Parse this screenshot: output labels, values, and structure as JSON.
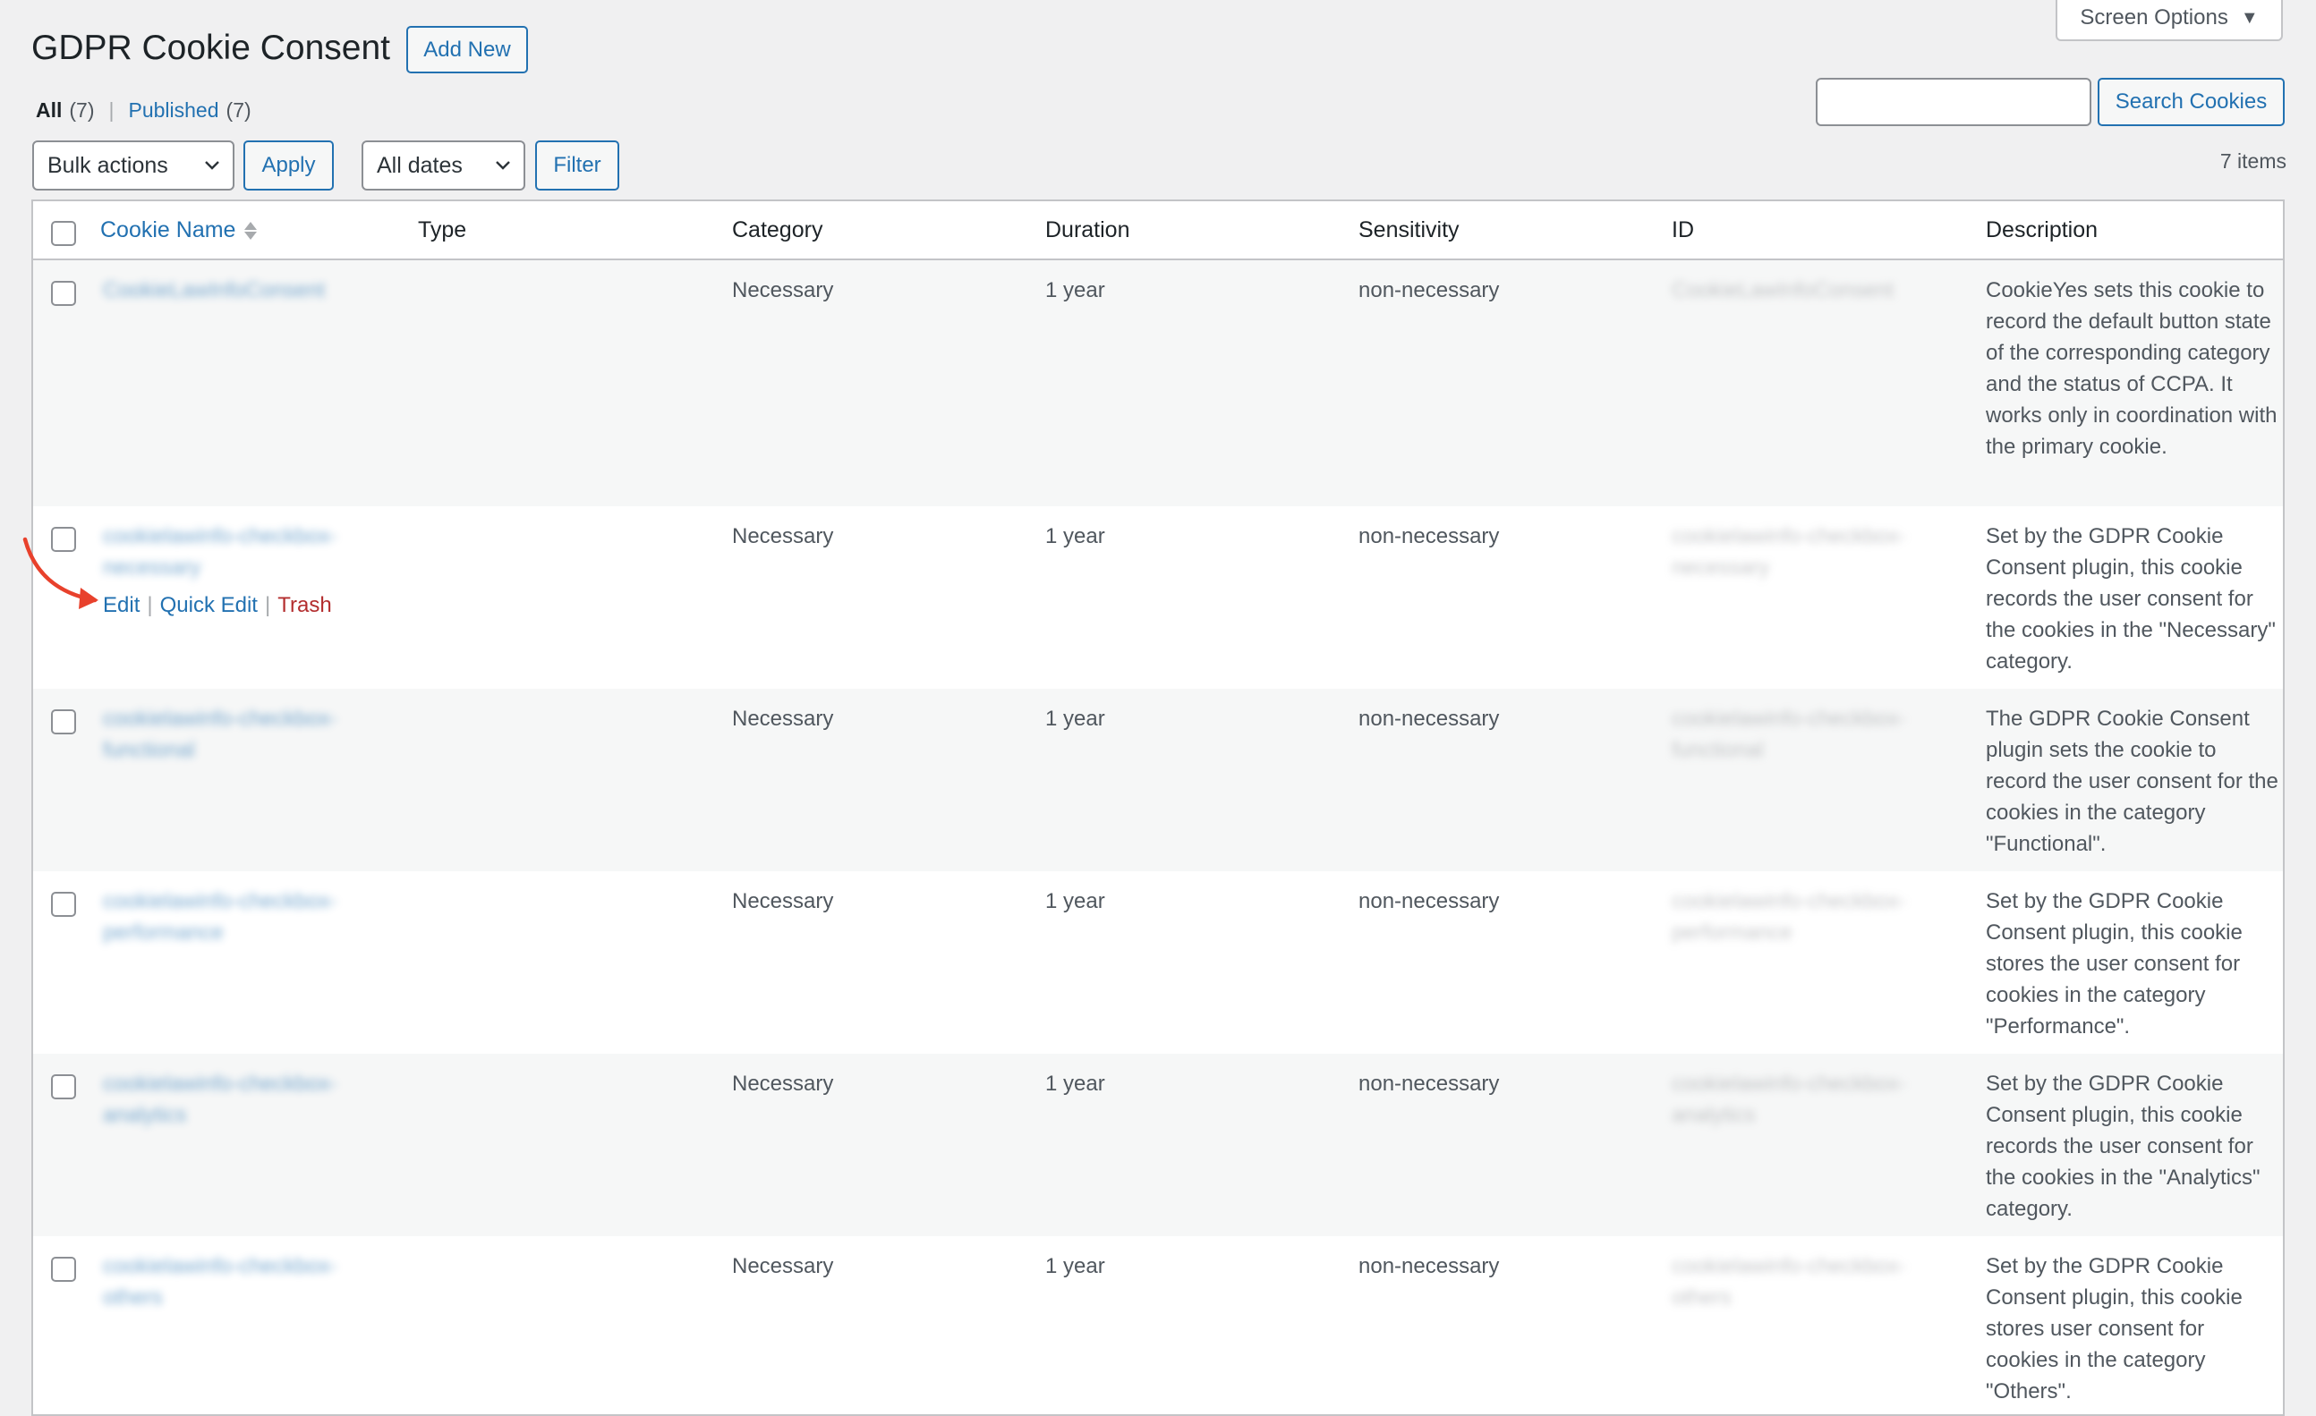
{
  "screen_options": {
    "label": "Screen Options",
    "icon": "triangle-down-icon"
  },
  "title": "GDPR Cookie Consent",
  "add_new": "Add New",
  "views": {
    "all": {
      "label": "All",
      "count": "(7)"
    },
    "sep": "|",
    "published": {
      "label": "Published",
      "count": "(7)"
    }
  },
  "search": {
    "value": "",
    "button": "Search Cookies"
  },
  "bulk_actions": {
    "selected": "Bulk actions",
    "apply": "Apply"
  },
  "dates": {
    "selected": "All dates",
    "filter": "Filter"
  },
  "items_count": "7 items",
  "columns": {
    "name": "Cookie Name",
    "type": "Type",
    "category": "Category",
    "duration": "Duration",
    "sensitivity": "Sensitivity",
    "id": "ID",
    "description": "Description"
  },
  "row_actions": {
    "edit": "Edit",
    "quick_edit": "Quick Edit",
    "trash": "Trash",
    "sep": "|"
  },
  "rows": [
    {
      "name": "CookieLawInfoConsent",
      "type": "",
      "category": "Necessary",
      "duration": "1 year",
      "sensitivity": "non-necessary",
      "id": "CookieLawInfoConsent",
      "description": "CookieYes sets this cookie to record the default button state of the corresponding category and the status of CCPA. It works only in coordination with the primary cookie."
    },
    {
      "name": "cookielawinfo-checkbox-necessary",
      "type": "",
      "category": "Necessary",
      "duration": "1 year",
      "sensitivity": "non-necessary",
      "id": "cookielawinfo-checkbox-necessary",
      "description": "Set by the GDPR Cookie Consent plugin, this cookie records the user consent for the cookies in the \"Necessary\" category."
    },
    {
      "name": "cookielawinfo-checkbox-functional",
      "type": "",
      "category": "Necessary",
      "duration": "1 year",
      "sensitivity": "non-necessary",
      "id": "cookielawinfo-checkbox-functional",
      "description": "The GDPR Cookie Consent plugin sets the cookie to record the user consent for the cookies in the category \"Functional\"."
    },
    {
      "name": "cookielawinfo-checkbox-performance",
      "type": "",
      "category": "Necessary",
      "duration": "1 year",
      "sensitivity": "non-necessary",
      "id": "cookielawinfo-checkbox-performance",
      "description": "Set by the GDPR Cookie Consent plugin, this cookie stores the user consent for cookies in the category \"Performance\"."
    },
    {
      "name": "cookielawinfo-checkbox-analytics",
      "type": "",
      "category": "Necessary",
      "duration": "1 year",
      "sensitivity": "non-necessary",
      "id": "cookielawinfo-checkbox-analytics",
      "description": "Set by the GDPR Cookie Consent plugin, this cookie records the user consent for the cookies in the \"Analytics\" category."
    },
    {
      "name": "cookielawinfo-checkbox-others",
      "type": "",
      "category": "Necessary",
      "duration": "1 year",
      "sensitivity": "non-necessary",
      "id": "cookielawinfo-checkbox-others",
      "description": "Set by the GDPR Cookie Consent plugin, this cookie stores user consent for cookies in the category \"Others\"."
    }
  ],
  "colors": {
    "link": "#2271b1",
    "trash": "#b32d2e",
    "annotation_arrow": "#e8412c",
    "page_bg": "#f0f0f1"
  }
}
